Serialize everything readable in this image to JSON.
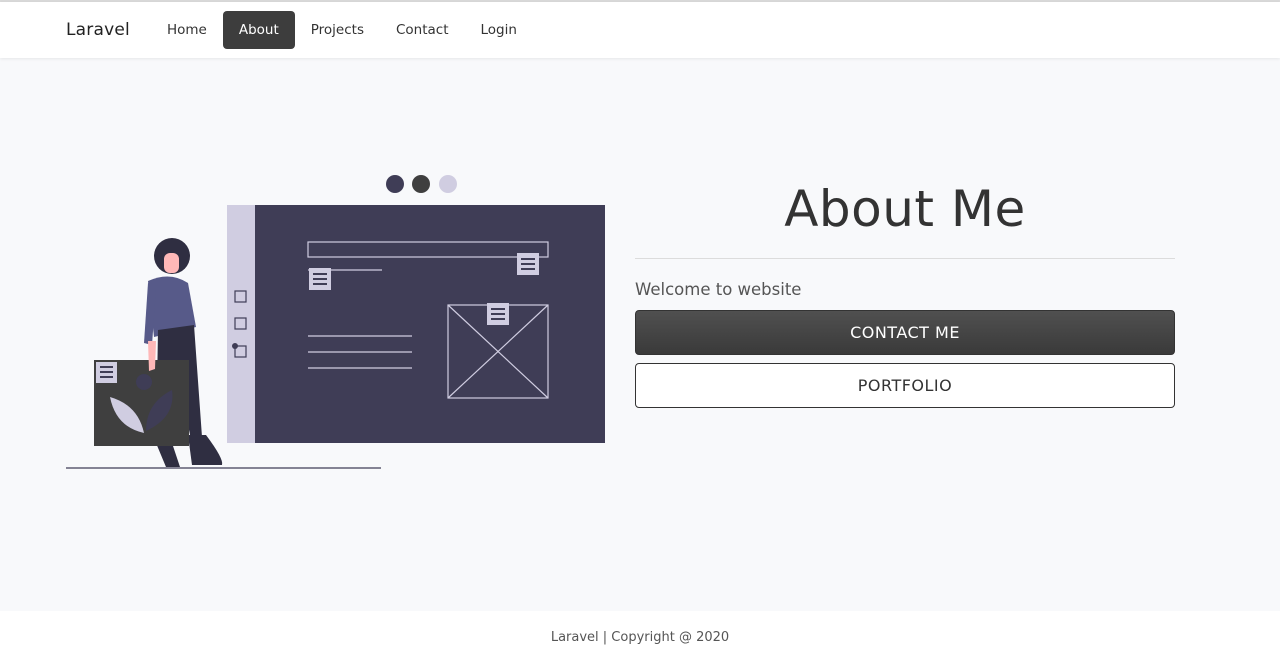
{
  "navbar": {
    "brand": "Laravel",
    "links": [
      {
        "label": "Home",
        "active": false
      },
      {
        "label": "About",
        "active": true
      },
      {
        "label": "Projects",
        "active": false
      },
      {
        "label": "Contact",
        "active": false
      },
      {
        "label": "Login",
        "active": false
      }
    ]
  },
  "about": {
    "title": "About Me",
    "welcome": "Welcome to website",
    "contact_button": "CONTACT ME",
    "portfolio_button": "PORTFOLIO"
  },
  "footer": {
    "text": "Laravel | Copyright @ 2020"
  },
  "colors": {
    "page_bg": "#f8f9fb",
    "nav_active_bg": "#3d3d3d",
    "illustration_screen": "#3f3d56",
    "illustration_sidebar": "#d0cde1",
    "illustration_dark": "#3f3f3f",
    "illustration_accent": "#575a89"
  }
}
